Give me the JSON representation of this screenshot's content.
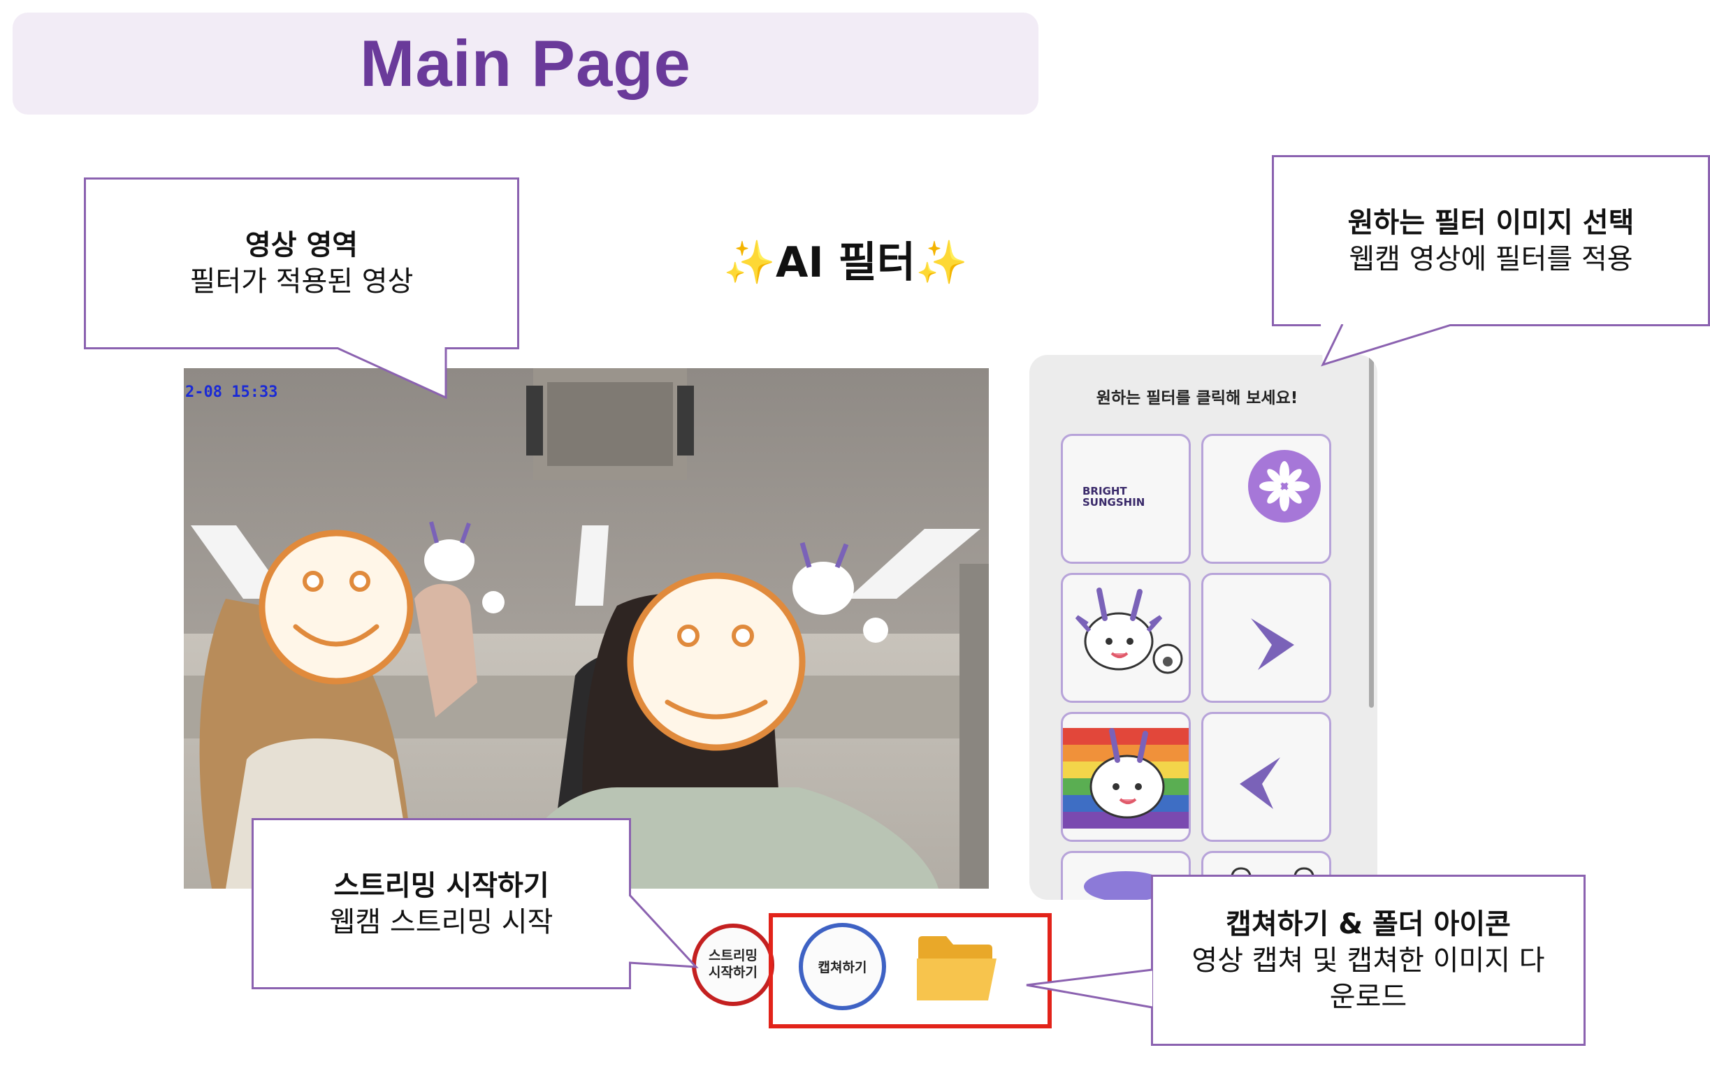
{
  "header": {
    "title": "Main Page"
  },
  "app": {
    "title": "✨AI 필터✨"
  },
  "video": {
    "timestamp": "2-08 15:33"
  },
  "filter_panel": {
    "prompt": "원하는 필터를 클릭해 보세요!",
    "tiles": [
      {
        "name": "bright-sungshin-logo",
        "text": "BRIGHT\nSUNGSHIN"
      },
      {
        "name": "purple-flower-emblem"
      },
      {
        "name": "dragon-character"
      },
      {
        "name": "purple-chevron-right"
      },
      {
        "name": "rainbow-dragon"
      },
      {
        "name": "purple-chevron-left"
      }
    ]
  },
  "controls": {
    "stream_button": "스트리밍\n시작하기",
    "capture_button": "캡쳐하기",
    "folder_icon": "folder-icon"
  },
  "callouts": {
    "video_area": {
      "title": "영상 영역",
      "desc": "필터가 적용된 영상"
    },
    "filter_select": {
      "title": "원하는 필터 이미지 선택",
      "desc": "웹캠 영상에 필터를 적용"
    },
    "streaming": {
      "title": "스트리밍 시작하기",
      "desc": "웹캠 스트리밍 시작"
    },
    "capture_folder": {
      "title": "캡쳐하기 & 폴더 아이콘",
      "desc": "영상 캡쳐 및 캡쳐한 이미지 다운로드"
    }
  },
  "colors": {
    "accent_purple": "#6a3a9a",
    "callout_border": "#8b62b0",
    "highlight_red": "#e2231a",
    "stream_ring": "#c42020",
    "capture_ring": "#3e62c4",
    "smiley_orange": "#e08a3c"
  }
}
